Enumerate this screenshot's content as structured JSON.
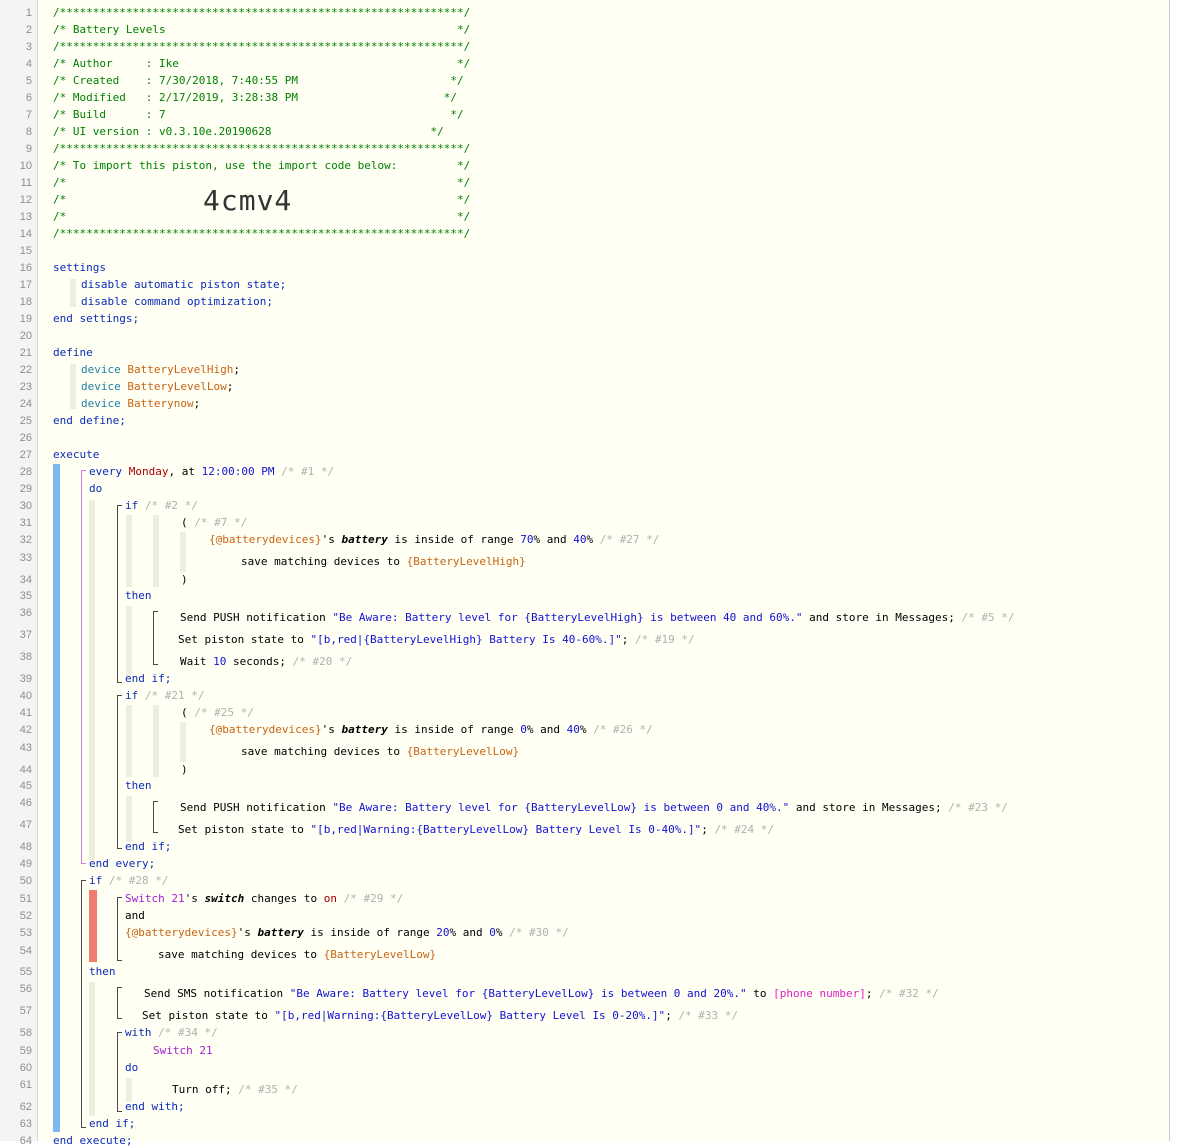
{
  "header": {
    "border": "/*************************************************************/",
    "title": "/* Battery Levels                                            */",
    "author": "/* Author     : Ike                                          */",
    "created": "/* Created    : 7/30/2018, 7:40:55 PM                       */",
    "modified": "/* Modified   : 2/17/2019, 3:28:38 PM                      */",
    "build": "/* Build      : 7                                           */",
    "ui_version": "/* UI version : v0.3.10e.20190628                        */",
    "import_text": "/* To import this piston, use the import code below:         */",
    "empty": "/*                                                           */",
    "import_code": "4cmv4",
    "empty_tail": "*/"
  },
  "settings": {
    "open": "settings",
    "line1": "disable automatic piston state;",
    "line2": "disable command optimization;",
    "close": "end settings;"
  },
  "define": {
    "open": "define",
    "kw": "device",
    "dev1": "BatteryLevelHigh",
    "dev2": "BatteryLevelLow",
    "dev3": "Batterynow",
    "semi": ";",
    "close": "end define;"
  },
  "execute": {
    "open": "execute",
    "every": "every",
    "monday": "Monday",
    "at": ", at ",
    "time": "12:00:00 PM",
    "c1": "/* #1 */",
    "do": "do",
    "if": "if",
    "c2": "/* #2 */",
    "paren_open": "(",
    "c7": "/* #7 */",
    "batt_var": "{@batterydevices}",
    "s": "'s ",
    "battery": "battery",
    "range_text": " is inside of range ",
    "v70": "70",
    "pct": "%",
    "and": " and ",
    "v40": "40",
    "c27": "/* #27 */",
    "save": "save matching devices to ",
    "high_var": "{BatteryLevelHigh}",
    "paren_close": ")",
    "then": "then",
    "push_label": "Send PUSH notification ",
    "push1": "\"Be Aware: Battery level for {BatteryLevelHigh} is between 40 and 60%.\"",
    "store": " and store in Messages;",
    "c5": "/* #5 */",
    "set_state": "Set piston state to ",
    "state1": "\"[b,red|{BatteryLevelHigh} Battery Is 40-60%.]\"",
    "semi": ";",
    "c19": "/* #19 */",
    "wait": "Wait ",
    "v10": "10",
    "seconds": " seconds;",
    "c20": "/* #20 */",
    "end_if": "end if;",
    "c21": "/* #21 */",
    "c25": "/* #25 */",
    "v0": "0",
    "c26": "/* #26 */",
    "low_var": "{BatteryLevelLow}",
    "push2": "\"Be Aware: Battery level for {BatteryLevelLow} is between 0 and 40%.\"",
    "c23": "/* #23 */",
    "state2": "\"[b,red|Warning:{BatteryLevelLow} Battery Level Is 0-40%.]\"",
    "c24": "/* #24 */",
    "end_every": "end every;",
    "c28": "/* #28 */",
    "switch21": "Switch 21",
    "switch_word": "switch",
    "changes": " changes to ",
    "on": "on",
    "c29": "/* #29 */",
    "and_word": "and",
    "v20": "20",
    "c30": "/* #30 */",
    "sms_label": "Send SMS notification ",
    "sms": "\"Be Aware: Battery level for {BatteryLevelLow} is between 0 and 20%.\"",
    "to": " to ",
    "phone": "[phone number]",
    "c32": "/* #32 */",
    "state3": "\"[b,red|Warning:{BatteryLevelLow} Battery Level Is 0-20%.]\"",
    "c33": "/* #33 */",
    "with": "with",
    "c34": "/* #34 */",
    "turn_off": "Turn off;",
    "c35": "/* #35 */",
    "end_with": "end with;",
    "close": "end execute;"
  },
  "colors": {
    "blue_bar": "#7cb8f0",
    "red_bar": "#f07c6c",
    "purple_line": "#d080e0"
  }
}
